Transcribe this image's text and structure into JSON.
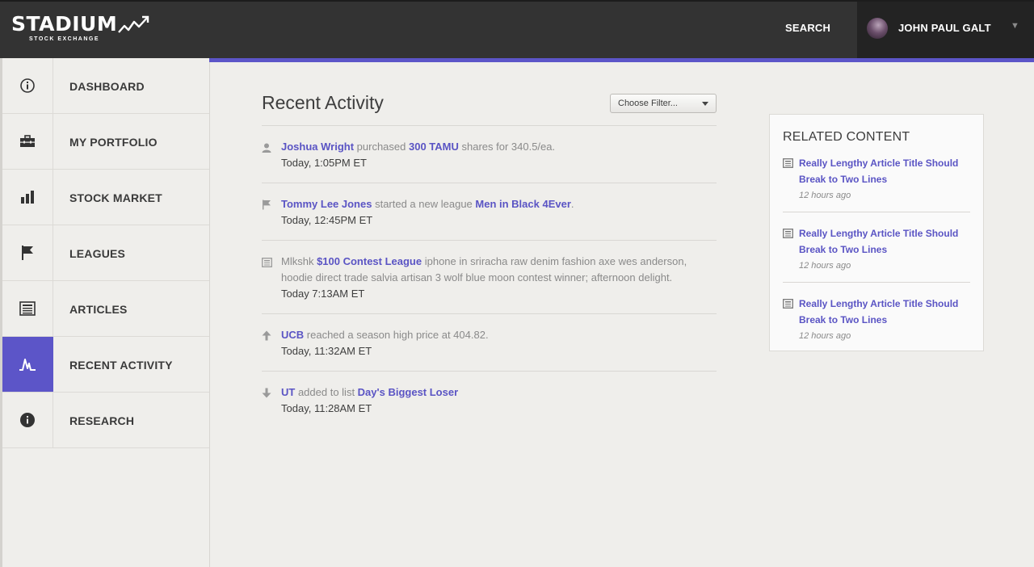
{
  "header": {
    "logo": "STADIUM",
    "logo_sub": "STOCK EXCHANGE",
    "search_label": "SEARCH",
    "user_name": "JOHN PAUL GALT",
    "caret": "▼"
  },
  "sidebar": {
    "items": [
      {
        "label": "DASHBOARD",
        "icon": "info-circle-icon"
      },
      {
        "label": "MY PORTFOLIO",
        "icon": "briefcase-icon"
      },
      {
        "label": "STOCK MARKET",
        "icon": "bar-chart-icon"
      },
      {
        "label": "LEAGUES",
        "icon": "flag-icon"
      },
      {
        "label": "ARTICLES",
        "icon": "newspaper-icon"
      },
      {
        "label": "RECENT ACTIVITY",
        "icon": "activity-pulse-icon",
        "active": true
      },
      {
        "label": "RESEARCH",
        "icon": "info-filled-icon"
      }
    ]
  },
  "main": {
    "title": "Recent Activity",
    "filter_label": "Choose Filter...",
    "activities": [
      {
        "icon": "user-icon",
        "parts": [
          {
            "text": "Joshua Wright",
            "link": true
          },
          {
            "text": " purchased ",
            "link": false
          },
          {
            "text": "300 TAMU",
            "link": true
          },
          {
            "text": " shares for 340.5/ea.",
            "link": false
          }
        ],
        "time": "Today, 1:05PM ET"
      },
      {
        "icon": "flag-icon",
        "parts": [
          {
            "text": "Tommy Lee Jones",
            "link": true
          },
          {
            "text": " started a new league ",
            "link": false
          },
          {
            "text": "Men in Black 4Ever",
            "link": true
          },
          {
            "text": ".",
            "link": false
          }
        ],
        "time": "Today, 12:45PM ET"
      },
      {
        "icon": "newspaper-icon",
        "parts": [
          {
            "text": "Mlkshk ",
            "link": false
          },
          {
            "text": "$100 Contest League",
            "link": true
          },
          {
            "text": " iphone in sriracha raw denim fashion axe wes anderson, hoodie direct trade salvia artisan 3 wolf blue moon contest winner; afternoon delight.",
            "link": false
          }
        ],
        "time": "Today 7:13AM ET"
      },
      {
        "icon": "arrow-up-icon",
        "parts": [
          {
            "text": "UCB",
            "link": true
          },
          {
            "text": " reached a season high price at 404.82.",
            "link": false
          }
        ],
        "time": "Today, 11:32AM ET"
      },
      {
        "icon": "arrow-down-icon",
        "parts": [
          {
            "text": "UT",
            "link": true
          },
          {
            "text": " added to list ",
            "link": false
          },
          {
            "text": "Day's Biggest Loser",
            "link": true
          }
        ],
        "time": "Today, 11:28AM ET"
      }
    ]
  },
  "related": {
    "title": "RELATED CONTENT",
    "items": [
      {
        "title": "Really Lengthy Article Title Should Break to Two Lines",
        "time": "12 hours ago"
      },
      {
        "title": "Really Lengthy Article Title Should Break to Two Lines",
        "time": "12 hours ago"
      },
      {
        "title": "Really Lengthy Article Title Should Break to Two Lines",
        "time": "12 hours ago"
      }
    ]
  },
  "colors": {
    "accent": "#5c55c8",
    "topbar": "#333333",
    "link": "#5a54c4"
  }
}
